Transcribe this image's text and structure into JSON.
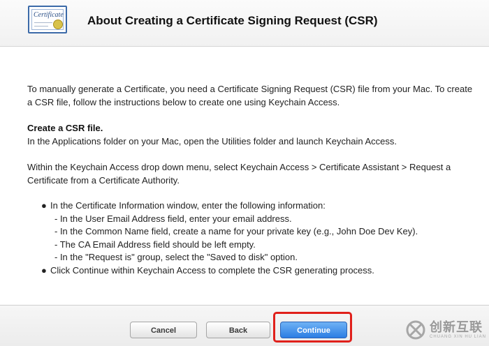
{
  "header": {
    "title": "About Creating a Certificate Signing Request (CSR)",
    "icon_text": "Certificate"
  },
  "content": {
    "intro": "To manually generate a Certificate, you need a Certificate Signing Request (CSR) file from your Mac. To create a CSR file, follow the instructions below to create one using Keychain Access.",
    "section_title": "Create a CSR file.",
    "section_text": "In the Applications folder on your Mac, open the Utilities folder and launch Keychain Access.",
    "menu_text": "Within the Keychain Access drop down menu, select Keychain Access > Certificate Assistant > Request a Certificate from a Certificate Authority.",
    "bullets": [
      {
        "text": "In the Certificate Information window, enter the following information:",
        "sub": [
          "- In the User Email Address field, enter your email address.",
          "- In the Common Name field, create a name for your private key (e.g., John Doe Dev Key).",
          "- The CA Email Address field should be left empty.",
          "- In the \"Request is\" group, select the \"Saved to disk\" option."
        ]
      },
      {
        "text": "Click Continue within Keychain Access to complete the CSR generating process."
      }
    ]
  },
  "footer": {
    "cancel_label": "Cancel",
    "back_label": "Back",
    "continue_label": "Continue"
  },
  "watermark": {
    "cn": "创新互联",
    "en": "CHUANG XIN HU LIAN"
  },
  "colors": {
    "primary_button": "#2b7de3",
    "highlight": "#e0201b"
  }
}
